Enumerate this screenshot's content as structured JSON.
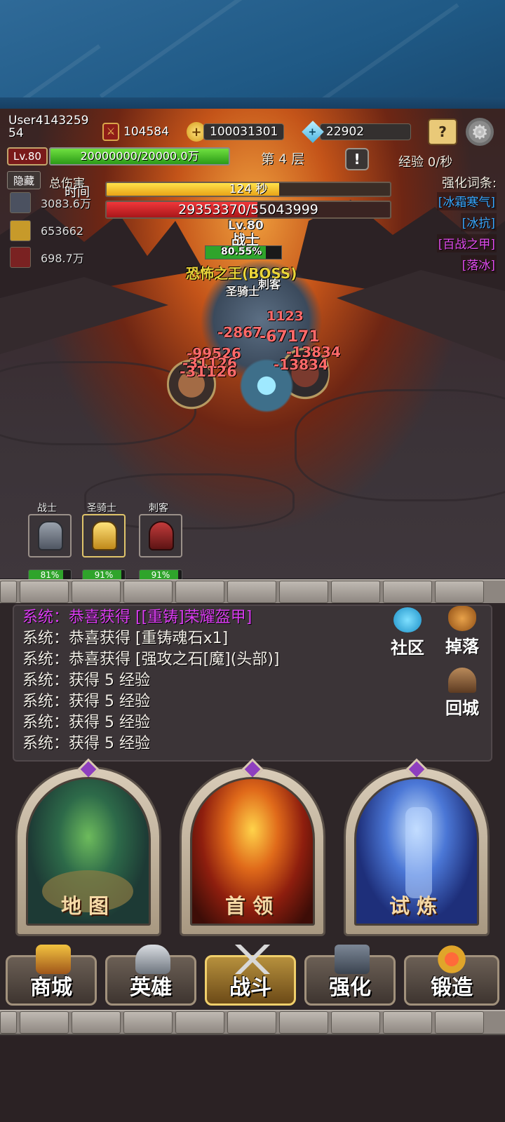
{
  "player": {
    "name": "User4143259\n54",
    "level": "Lv.80",
    "exp_text": "20000000/20000.0万",
    "exp_fill": 1.0
  },
  "resources": {
    "power": "104584",
    "gold": "100031301",
    "diamond": "22902"
  },
  "floor": "第 4 层",
  "exp_rate": "经验 0/秒",
  "hide_label": "隐藏",
  "total_damage_label": "总伤害",
  "damage_rows": [
    "3083.6万",
    "653662",
    "698.7万"
  ],
  "timer": {
    "label": "时间",
    "text": "124 秒",
    "fill": 0.61
  },
  "boss_hp": {
    "text": "29353370/55043999",
    "fill": 0.533
  },
  "affix_title": "强化词条:",
  "affixes": [
    {
      "text": "[冰霜寒气]",
      "color": "#3aa8ff"
    },
    {
      "text": "[冰抗]",
      "color": "#3aa8ff"
    },
    {
      "text": "[百战之甲]",
      "color": "#e24cf0"
    },
    {
      "text": "[落冰]",
      "color": "#e24cf0"
    }
  ],
  "combat": {
    "lv_tag": "Lv.80",
    "warrior_tag": "战士",
    "hp_pct": "80.55%",
    "boss_tag": "恐怖之王(BOSS)",
    "knight_tag": "圣骑士",
    "assassin_tag": "刺客",
    "dmg": [
      "-99526",
      "-31126",
      "-31126",
      "-13834",
      "-13834",
      "-2867",
      "1123",
      "-67171"
    ]
  },
  "heroes": [
    {
      "name": "战士",
      "hp": "81%",
      "fill": 0.81
    },
    {
      "name": "圣骑士",
      "hp": "91%",
      "fill": 0.91
    },
    {
      "name": "刺客",
      "hp": "91%",
      "fill": 0.91
    }
  ],
  "log": [
    {
      "text": "系统：恭喜获得 [[重铸]荣耀盔甲]",
      "color": "#d93cf0"
    },
    {
      "text": "系统：恭喜获得 [重铸魂石x1]",
      "color": "#f1ede6"
    },
    {
      "text": "系统：恭喜获得 [强攻之石[魔](头部)]",
      "color": "#f1ede6"
    },
    {
      "text": "系统：获得 5 经验",
      "color": "#f1ede6"
    },
    {
      "text": "系统：获得 5 经验",
      "color": "#f1ede6"
    },
    {
      "text": "系统：获得 5 经验",
      "color": "#f1ede6"
    },
    {
      "text": "系统：获得 5 经验",
      "color": "#f1ede6"
    }
  ],
  "side": {
    "community": "社区",
    "drops": "掉落",
    "return_city": "回城"
  },
  "portals": {
    "map": "地图",
    "boss": "首领",
    "trial": "试炼"
  },
  "nav": {
    "shop": "商城",
    "hero": "英雄",
    "battle": "战斗",
    "enhance": "强化",
    "forge": "锻造"
  },
  "colors": {
    "accent_gold": "#f0cf6b",
    "hp_red": "#e0282b",
    "exp_green": "#4fc62e",
    "timer_yellow": "#f6c228"
  }
}
